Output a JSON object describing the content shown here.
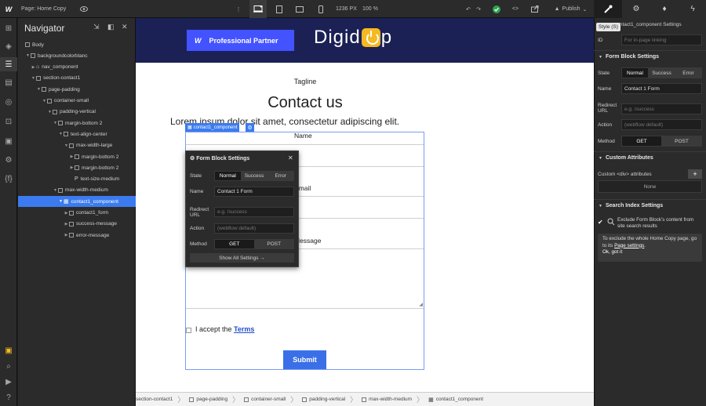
{
  "topbar": {
    "logo": "W",
    "page_label": "Page: Home Copy",
    "width": "1236",
    "width_unit": "PX",
    "zoom": "100 %",
    "publish": "Publish"
  },
  "navigator": {
    "title": "Navigator",
    "tree": [
      {
        "label": "Body",
        "depth": 0,
        "icon": "box"
      },
      {
        "label": "backgroundcolorblanc",
        "depth": 1,
        "icon": "box",
        "tw": "▼"
      },
      {
        "label": "nav_component",
        "depth": 2,
        "icon": "home",
        "tw": "▶"
      },
      {
        "label": "section-contact1",
        "depth": 2,
        "icon": "box",
        "tw": "▼"
      },
      {
        "label": "page-padding",
        "depth": 3,
        "icon": "box",
        "tw": "▼"
      },
      {
        "label": "container-small",
        "depth": 4,
        "icon": "box",
        "tw": "▼"
      },
      {
        "label": "padding-vertical",
        "depth": 5,
        "icon": "box",
        "tw": "▼"
      },
      {
        "label": "margin-bottom 2",
        "depth": 6,
        "icon": "box",
        "tw": "▼"
      },
      {
        "label": "text-align-center",
        "depth": 7,
        "icon": "box",
        "tw": "▼"
      },
      {
        "label": "max-width-large",
        "depth": 8,
        "icon": "box",
        "tw": "▼"
      },
      {
        "label": "margin-bottom 2",
        "depth": 9,
        "icon": "box",
        "tw": "▶"
      },
      {
        "label": "margin-bottom 2",
        "depth": 9,
        "icon": "box",
        "tw": "▶"
      },
      {
        "label": "text-size-medium",
        "depth": 9,
        "icon": "para"
      },
      {
        "label": "max-width-medium",
        "depth": 6,
        "icon": "box",
        "tw": "▼"
      },
      {
        "label": "contact1_component",
        "depth": 7,
        "icon": "form",
        "tw": "▼",
        "selected": true
      },
      {
        "label": "contact1_form",
        "depth": 8,
        "icon": "box",
        "tw": "▶"
      },
      {
        "label": "success-message",
        "depth": 8,
        "icon": "box",
        "tw": "▶"
      },
      {
        "label": "error-message",
        "depth": 8,
        "icon": "box",
        "tw": "▶"
      }
    ]
  },
  "canvas": {
    "partner_w": "W",
    "partner_label": "Professional Partner",
    "logo_a": "Digid",
    "logo_b": "p",
    "tagline": "Tagline",
    "title": "Contact us",
    "lorem": "Lorem ipsum dolor sit amet, consectetur adipiscing elit.",
    "component_tag": "contact1_component",
    "name_label": "Name",
    "email_label": "Email",
    "message_label": "Message",
    "accept_prefix": "I accept the",
    "terms": "Terms",
    "submit": "Submit"
  },
  "popup": {
    "title": "Form Block Settings",
    "state_label": "State",
    "states": [
      "Normal",
      "Success",
      "Error"
    ],
    "name_label": "Name",
    "name_value": "Contact 1 Form",
    "redirect_label": "Redirect URL",
    "redirect_placeholder": "e.g. /success",
    "action_label": "Action",
    "action_placeholder": "(webflow default)",
    "method_label": "Method",
    "methods": [
      "GET",
      "POST"
    ],
    "show_all": "Show All Settings"
  },
  "breadcrumbs": [
    "section-contact1",
    "page-padding",
    "container-small",
    "padding-vertical",
    "max-width-medium",
    "contact1_component"
  ],
  "right_panel": {
    "tooltip": "Style (S)",
    "settings_title": "contact1_component Settings",
    "id_label": "ID",
    "id_placeholder": "For in-page linking",
    "form_block": {
      "title": "Form Block Settings",
      "state_label": "State",
      "states": [
        "Normal",
        "Success",
        "Error"
      ],
      "name_label": "Name",
      "name_value": "Contact 1 Form",
      "redirect_label": "Redirect URL",
      "redirect_placeholder": "e.g. /success",
      "action_label": "Action",
      "action_placeholder": "(webflow default)",
      "method_label": "Method",
      "methods": [
        "GET",
        "POST"
      ]
    },
    "custom_attrs": {
      "title": "Custom Attributes",
      "sub": "Custom <div> attributes",
      "none": "None"
    },
    "search_index": {
      "title": "Search Index Settings",
      "exclude": "Exclude Form Block's content from site search results",
      "note": "To exclude the whole Home Copy page, go to its",
      "note_link": "Page settings",
      "note_end": ".",
      "ok": "Ok, got it"
    }
  },
  "colors": {
    "accent": "#3b7bef",
    "header": "#1b2155",
    "partner": "#4353ff",
    "logo_mark": "#f5b922",
    "submit": "#3b6fe8",
    "check": "#2ea44f"
  }
}
